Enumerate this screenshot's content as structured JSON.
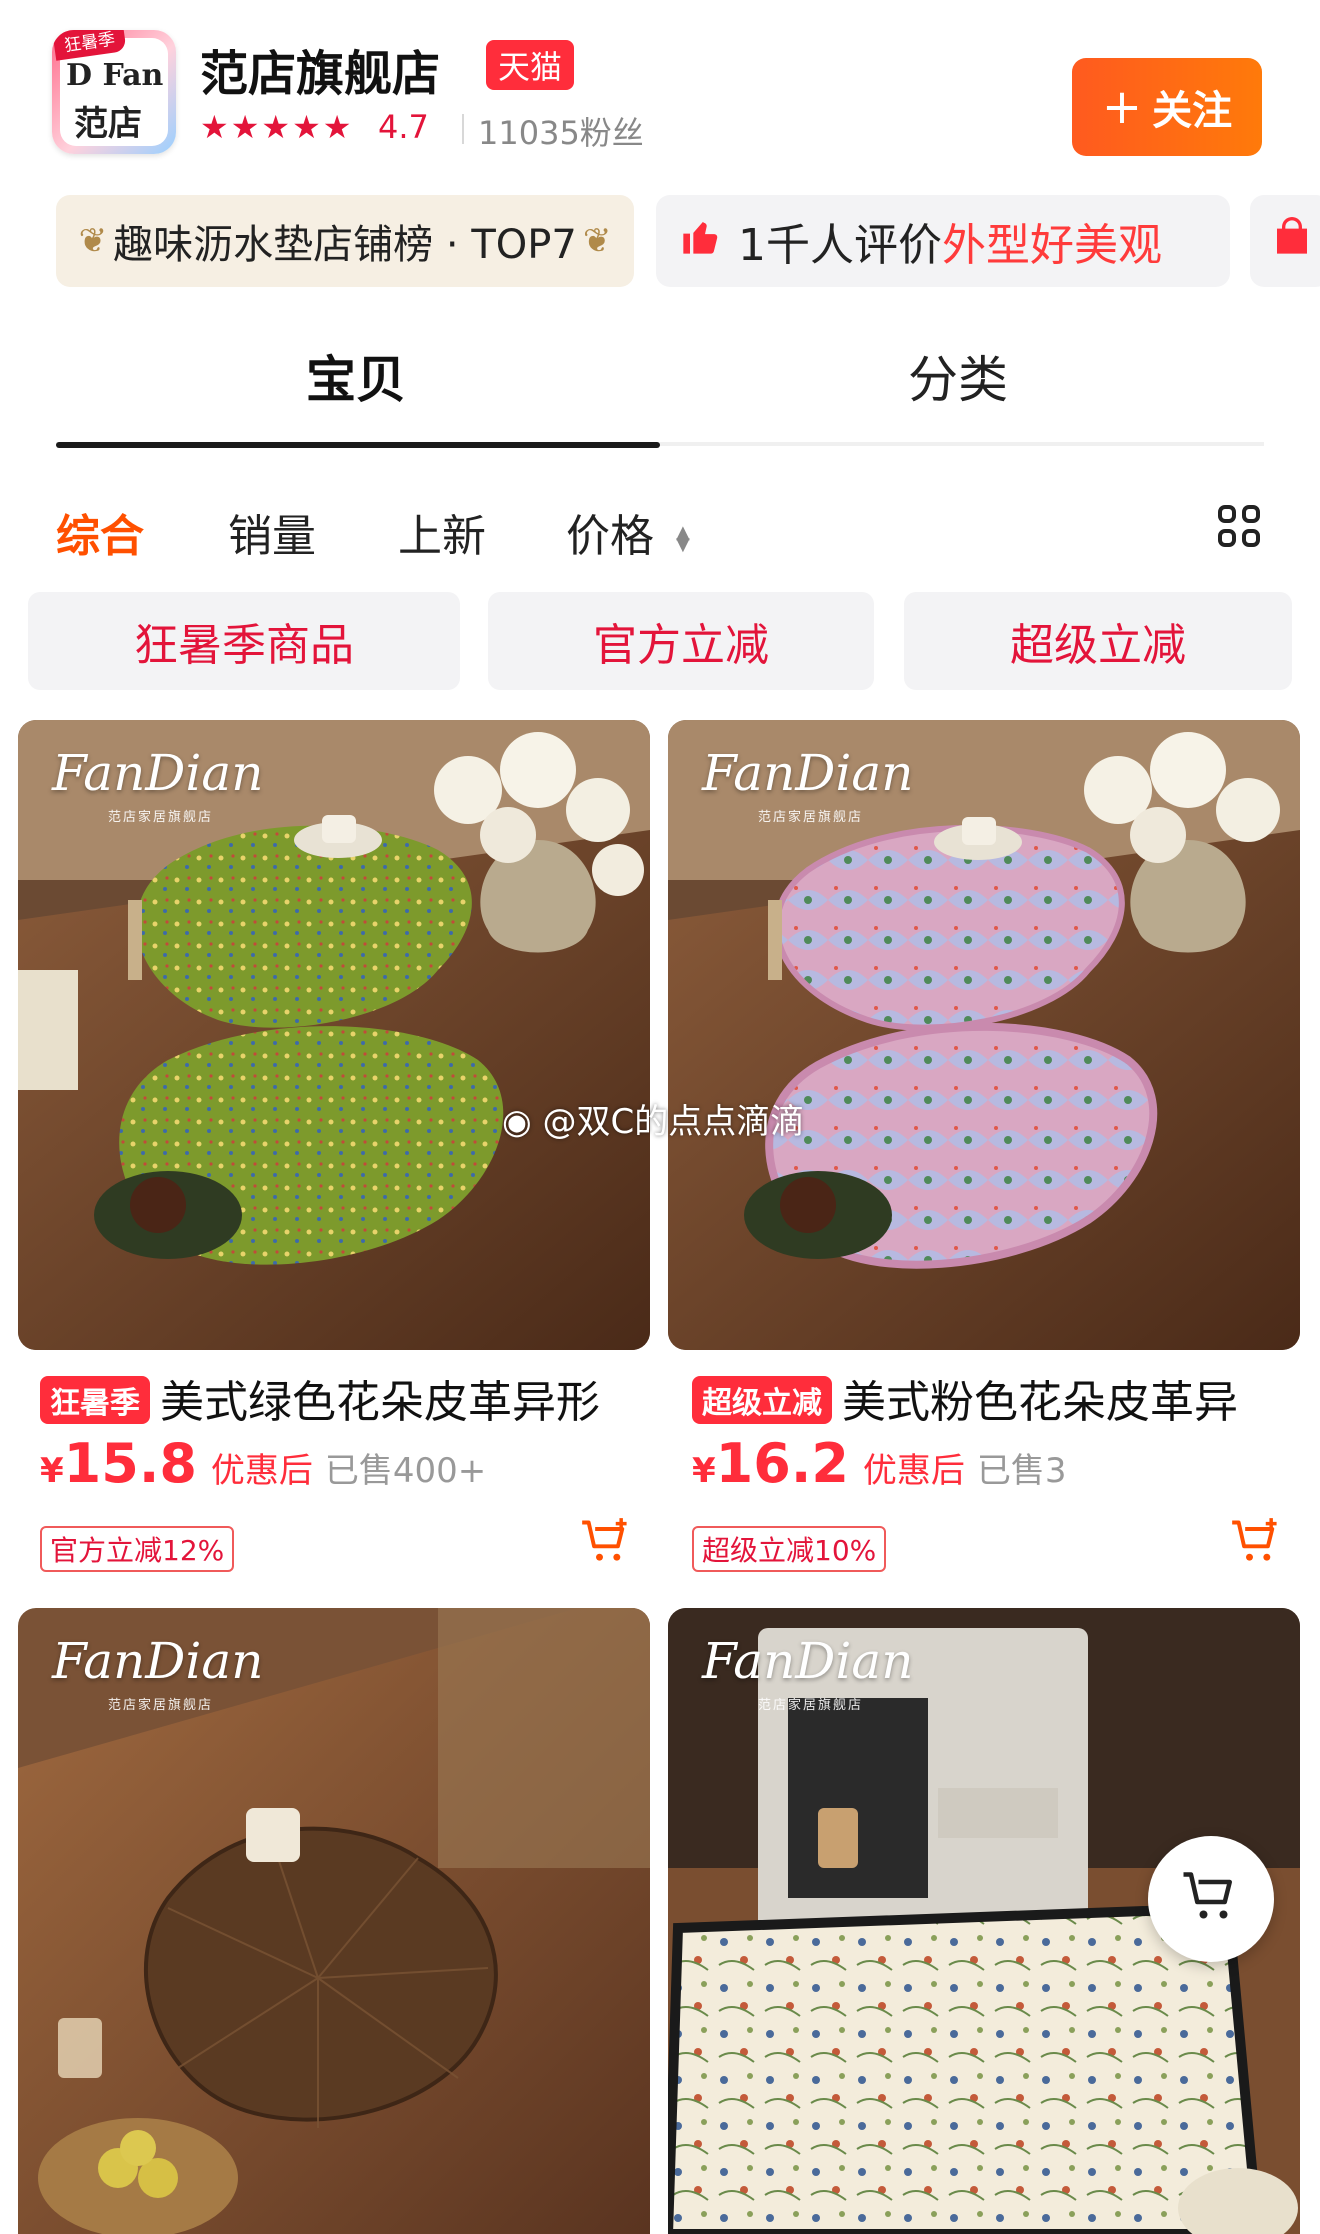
{
  "shop": {
    "logo_badge": "狂暑季",
    "logo_text_en": "D Fan",
    "logo_text_cn": "范店",
    "name": "范店旗舰店",
    "platform_tag": "天猫",
    "stars": "★★★★★",
    "rating": "4.7",
    "fans": "11035粉丝",
    "follow_label": "关注",
    "follow_icon": "+"
  },
  "promos": {
    "ranking": "趣味沥水垫店铺榜 · TOP7",
    "review_prefix": "1千人评价",
    "review_highlight": "外型好美观"
  },
  "tabs": {
    "items": [
      "宝贝",
      "分类"
    ],
    "active": "宝贝"
  },
  "sort": {
    "items": [
      "综合",
      "销量",
      "上新",
      "价格"
    ],
    "active": "综合"
  },
  "filters": [
    "狂暑季商品",
    "官方立减",
    "超级立减"
  ],
  "products": [
    {
      "brand": "FanDian",
      "brand_sub": "范店家居旗舰店",
      "tag": "狂暑季",
      "title": "美式绿色花朵皮革异形",
      "currency": "¥",
      "price": "15.8",
      "price_note": "优惠后",
      "sold": "已售400+",
      "discount": "官方立减12%"
    },
    {
      "brand": "FanDian",
      "brand_sub": "范店家居旗舰店",
      "tag": "超级立减",
      "title": "美式粉色花朵皮革异",
      "currency": "¥",
      "price": "16.2",
      "price_note": "优惠后",
      "sold": "已售3",
      "discount": "超级立减10%"
    },
    {
      "brand": "FanDian",
      "brand_sub": "范店家居旗舰店"
    },
    {
      "brand": "FanDian",
      "brand_sub": "范店家居旗舰店"
    }
  ],
  "watermark": "@双C的点点滴滴",
  "colors": {
    "accent": "#ff5000",
    "price_red": "#ff2d3b",
    "follow_gradient": [
      "#ff5a1f",
      "#ff7a0a"
    ]
  },
  "icons": [
    "thumbs-up-icon",
    "shopping-bag-icon",
    "grid-view-icon",
    "add-to-cart-icon",
    "cart-icon",
    "sort-arrows-icon",
    "weibo-icon"
  ]
}
